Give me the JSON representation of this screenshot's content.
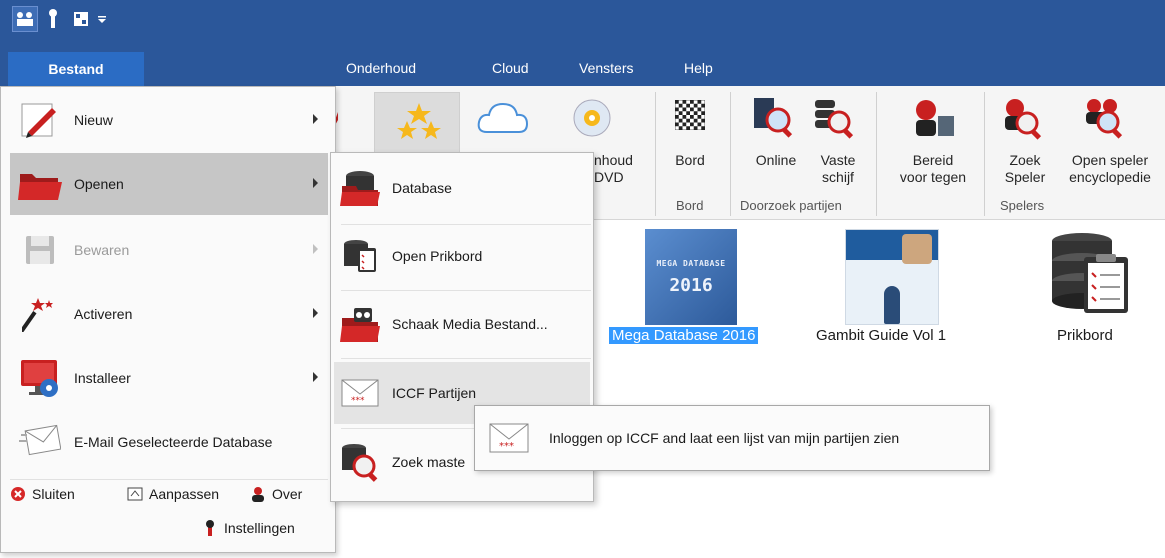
{
  "quick_access": {
    "icons": [
      "chess-pieces-icon",
      "wrench-icon",
      "grid-icon",
      "dropdown-arrow-icon"
    ]
  },
  "menu": {
    "bestand": "Bestand",
    "tabs": [
      "Onderhoud",
      "Cloud",
      "Vensters",
      "Help"
    ]
  },
  "ribbon": {
    "inhoud_dvd": [
      "nhoud",
      "DVD"
    ],
    "bord_btn": "Bord",
    "bord_group": "Bord",
    "online": "Online",
    "vaste_schijf": [
      "Vaste",
      "schijf"
    ],
    "doorzoek_group": "Doorzoek partijen",
    "bereid": [
      "Bereid",
      "voor tegen"
    ],
    "zoek_speler": [
      "Zoek",
      "Speler"
    ],
    "open_speler": [
      "Open speler",
      "encyclopedie"
    ],
    "spelers_group": "Spelers"
  },
  "content": {
    "items": [
      {
        "label": "Mega Database 2016",
        "selected": true,
        "cover_text": [
          "MEGA DATABASE",
          "2016"
        ]
      },
      {
        "label": "Gambit Guide Vol 1",
        "selected": false
      },
      {
        "label": "Prikbord",
        "selected": false
      }
    ]
  },
  "file_menu": {
    "items": [
      {
        "label": "Nieuw",
        "icon": "pencil-icon",
        "has_submenu": true,
        "enabled": true
      },
      {
        "label": "Openen",
        "icon": "folder-icon",
        "has_submenu": true,
        "enabled": true,
        "highlighted": true
      },
      {
        "label": "Bewaren",
        "icon": "floppy-icon",
        "has_submenu": true,
        "enabled": false
      },
      {
        "label": "Activeren",
        "icon": "magic-wand-icon",
        "has_submenu": true,
        "enabled": true
      },
      {
        "label": "Installeer",
        "icon": "monitor-install-icon",
        "has_submenu": true,
        "enabled": true
      },
      {
        "label": "E-Mail Geselecteerde Database",
        "icon": "envelope-icon",
        "has_submenu": false,
        "enabled": true
      }
    ],
    "footer": {
      "sluiten": "Sluiten",
      "aanpassen": "Aanpassen",
      "over": "Over",
      "instellingen": "Instellingen"
    }
  },
  "submenu": {
    "items": [
      {
        "label": "Database",
        "icon": "database-folder-icon"
      },
      {
        "label": "Open Prikbord",
        "icon": "database-clipboard-icon"
      },
      {
        "label": "Schaak Media Bestand...",
        "icon": "media-folder-icon"
      },
      {
        "label": "ICCF Partijen",
        "icon": "iccf-envelope-icon",
        "highlighted": true
      },
      {
        "label": "Zoek maste",
        "icon": "database-search-icon"
      }
    ]
  },
  "tooltip": {
    "text": "Inloggen op ICCF and laat een lijst van mijn partijen zien"
  },
  "colors": {
    "titlebar": "#2b579a",
    "bestand_tab": "#2b6cc4",
    "selection": "#3399ff",
    "menu_highlight": "#c6c6c6"
  }
}
